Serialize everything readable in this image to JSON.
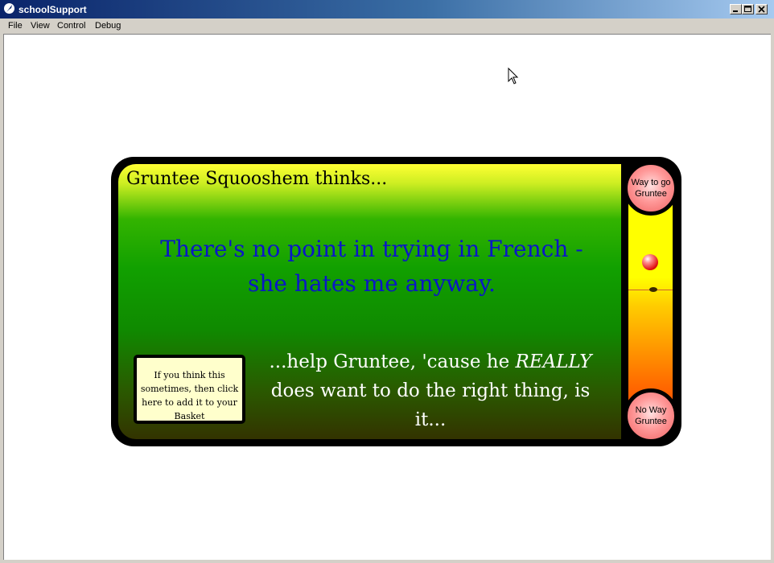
{
  "window": {
    "title": "schoolSupport",
    "controls": [
      "minimize",
      "maximize",
      "close"
    ]
  },
  "menu": {
    "file": "File",
    "view": "View",
    "control": "Control",
    "debug": "Debug"
  },
  "card": {
    "speaker": "Gruntee Squooshem thinks...",
    "thought": "There's no point in trying in French - she hates me anyway.",
    "help_prefix": "...help Gruntee, 'cause he ",
    "help_emphasis": "REALLY",
    "help_suffix": " does want to do the right thing, is it...",
    "basket_button": "If you think this sometimes, then click here to add it to your Basket"
  },
  "meter": {
    "top_button": "Way to go Gruntee",
    "bottom_button": "No Way Gruntee",
    "ball_level": 0.68,
    "marker_level": 0.55
  },
  "colors": {
    "thought_text": "#0a16c8",
    "help_text": "#ffffff",
    "basket_bg": "#ffffcc",
    "button_pink": "#ff9a9a",
    "meter_top": "#ffff00",
    "meter_bottom": "#ff4000"
  }
}
